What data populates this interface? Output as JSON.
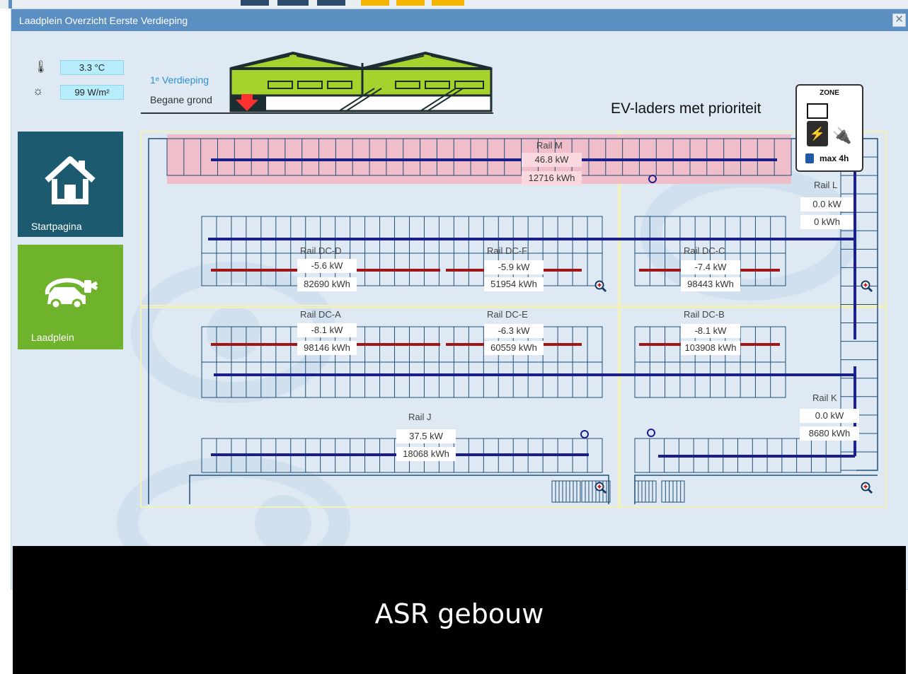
{
  "window": {
    "title": "Laadplein Overzicht Eerste Verdieping",
    "close_label": "✕"
  },
  "sensors": {
    "temperature": {
      "value": "3.3 °C",
      "icon": "thermometer-icon"
    },
    "irradiance": {
      "value": "99 W/m²",
      "icon": "sun-icon"
    }
  },
  "floors": {
    "first": "1ᵉ Verdieping",
    "ground": "Begane grond"
  },
  "nav": {
    "home_label": "Startpagina",
    "charging_label": "Laadplein"
  },
  "legend": {
    "title": "EV-laders met prioriteit",
    "zone_label": "ZONE",
    "max_label": "max 4h"
  },
  "rails": [
    {
      "name": "Rail M",
      "power": "46.8 kW",
      "energy": "12716 kWh"
    },
    {
      "name": "Rail L",
      "power": "0.0 kW",
      "energy": "0 kWh"
    },
    {
      "name": "Rail DC-D",
      "power": "-5.6 kW",
      "energy": "82690 kWh"
    },
    {
      "name": "Rail DC-F",
      "power": "-5.9 kW",
      "energy": "51954 kWh"
    },
    {
      "name": "Rail DC-C",
      "power": "-7.4 kW",
      "energy": "98443 kWh"
    },
    {
      "name": "Rail DC-A",
      "power": "-8.1 kW",
      "energy": "98146 kWh"
    },
    {
      "name": "Rail DC-E",
      "power": "-6.3 kW",
      "energy": "60559 kWh"
    },
    {
      "name": "Rail DC-B",
      "power": "-8.1 kW",
      "energy": "103908 kWh"
    },
    {
      "name": "Rail J",
      "power": "37.5 kW",
      "energy": "18068 kWh"
    },
    {
      "name": "Rail K",
      "power": "0.0 kW",
      "energy": "8680 kWh"
    }
  ],
  "caption": "ASR gebouw",
  "colors": {
    "titlebar": "#5b8fc2",
    "home_tile": "#1c5a70",
    "charging_tile": "#6fb22b",
    "ac_rail": "#1b1f8a",
    "dc_rail": "#a01515",
    "priority_zone": "#f2b6c2"
  }
}
